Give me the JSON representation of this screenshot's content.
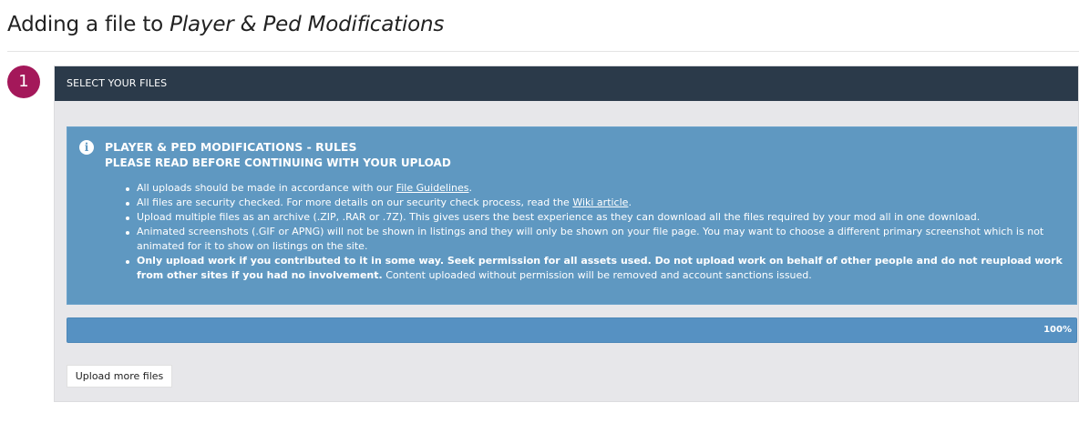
{
  "page": {
    "title_prefix": "Adding a file to ",
    "title_category": "Player & Ped Modifications"
  },
  "step": {
    "number": "1",
    "header": "SELECT YOUR FILES"
  },
  "rules": {
    "icon": "info-icon",
    "title": "PLAYER & PED MODIFICATIONS - RULES",
    "subtitle": "PLEASE READ BEFORE CONTINUING WITH YOUR UPLOAD",
    "item1_text": "All uploads should be made in accordance with our ",
    "item1_link": "File Guidelines",
    "item1_end": ".",
    "item2_text": "All files are security checked. For more details on our security check process, read the ",
    "item2_link": "Wiki article",
    "item2_end": ".",
    "item3_text": "Upload multiple files as an archive (.ZIP, .RAR or .7Z). This gives users the best experience as they can download all the files required by your mod all in one download.",
    "item4_text": "Animated screenshots (.GIF or APNG) will not be shown in listings and they will only be shown on your file page. You may want to choose a different primary screenshot which is not animated for it to show on listings on the site.",
    "item5_bold": "Only upload work if you contributed to it in some way. Seek permission for all assets used. Do not upload work on behalf of other people and do not reupload work from other sites if you had no involvement.",
    "item5_text": " Content uploaded without permission will be removed and account sanctions issued."
  },
  "progress": {
    "percent": 100,
    "label": "100%"
  },
  "actions": {
    "upload_more_label": "Upload more files"
  },
  "colors": {
    "badge": "#a4185a",
    "header_bg": "#2b3a4a",
    "rules_bg": "#5f98c1",
    "progress_bg": "#5691c2"
  }
}
